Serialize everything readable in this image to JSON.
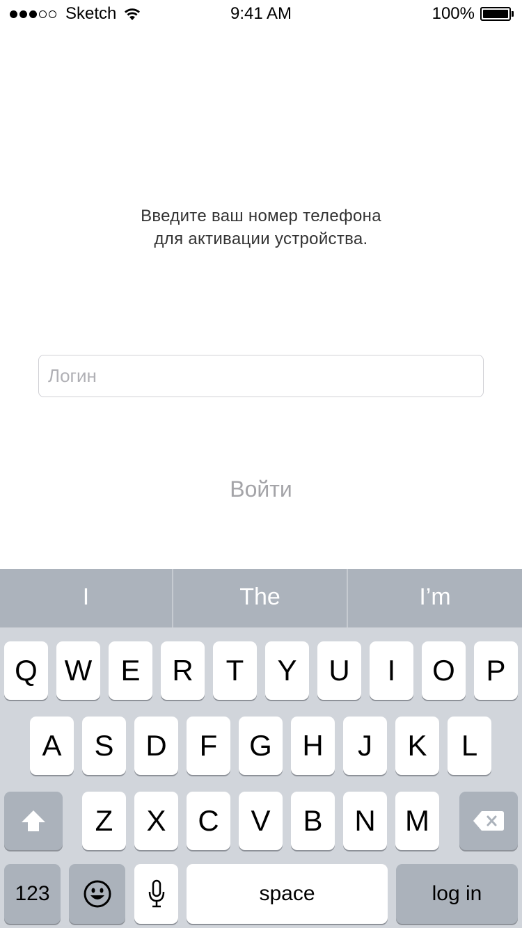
{
  "status_bar": {
    "carrier": "Sketch",
    "time": "9:41 AM",
    "battery": "100%",
    "signal_bars_filled": 3,
    "signal_bars_total": 5
  },
  "instruction": {
    "line1": "Введите ваш номер телефона",
    "line2": "для активации устройства."
  },
  "login_field": {
    "placeholder": "Логин",
    "value": ""
  },
  "submit_button": {
    "label": "Войти"
  },
  "keyboard": {
    "suggestions": [
      "I",
      "The",
      "I’m"
    ],
    "row1": [
      "Q",
      "W",
      "E",
      "R",
      "T",
      "Y",
      "U",
      "I",
      "O",
      "P"
    ],
    "row2": [
      "A",
      "S",
      "D",
      "F",
      "G",
      "H",
      "J",
      "K",
      "L"
    ],
    "row3": [
      "Z",
      "X",
      "C",
      "V",
      "B",
      "N",
      "M"
    ],
    "numbers_label": "123",
    "space_label": "space",
    "return_label": "log in",
    "icons": {
      "shift": "shift-icon",
      "delete": "delete-icon",
      "emoji": "emoji-icon",
      "dictation": "microphone-icon"
    }
  },
  "colors": {
    "keyboard_bg": "#d1d5db",
    "suggestion_bar_bg": "#acb3bc",
    "special_key_bg": "#abb2bb",
    "submit_text": "#a4a4a8"
  }
}
